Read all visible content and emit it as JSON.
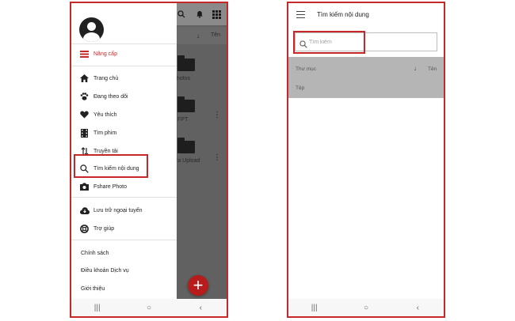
{
  "left_screen": {
    "background": {
      "sort_label": "Tên",
      "folders": [
        {
          "label": "hotos"
        },
        {
          "label": "FPT"
        },
        {
          "label": "ra Upload"
        }
      ]
    },
    "drawer": {
      "upgrade_label": "Nâng cấp",
      "items": [
        {
          "label": "Trang chủ",
          "icon": "home-icon"
        },
        {
          "label": "Đang theo dõi",
          "icon": "paw-icon"
        },
        {
          "label": "Yêu thích",
          "icon": "heart-icon"
        },
        {
          "label": "Tìm phim",
          "icon": "film-icon"
        },
        {
          "label": "Truyền tải",
          "icon": "transfer-icon"
        },
        {
          "label": "Tìm kiếm nội dung",
          "icon": "search-icon"
        },
        {
          "label": "Fshare Photo",
          "icon": "camera-icon"
        }
      ],
      "items2": [
        {
          "label": "Lưu trữ ngoại tuyến",
          "icon": "cloud-download-icon"
        },
        {
          "label": "Trợ giúp",
          "icon": "help-icon"
        }
      ],
      "links": [
        {
          "label": "Chính sách"
        },
        {
          "label": "Điều khoản Dịch vụ"
        },
        {
          "label": "Giới thiệu"
        }
      ]
    },
    "fab_label": "+"
  },
  "right_screen": {
    "title": "Tìm kiếm nội dung",
    "search": {
      "placeholder": "Tìm kiếm",
      "value": ""
    },
    "results": {
      "folder_label": "Thư mục",
      "sort_label": "Tên",
      "file_label": "Tệp"
    }
  },
  "nav": {
    "recents": "|||",
    "home": "○",
    "back": "‹"
  },
  "colors": {
    "highlight": "#c62828",
    "upgrade": "#c62828",
    "fab": "#b71c1c"
  }
}
